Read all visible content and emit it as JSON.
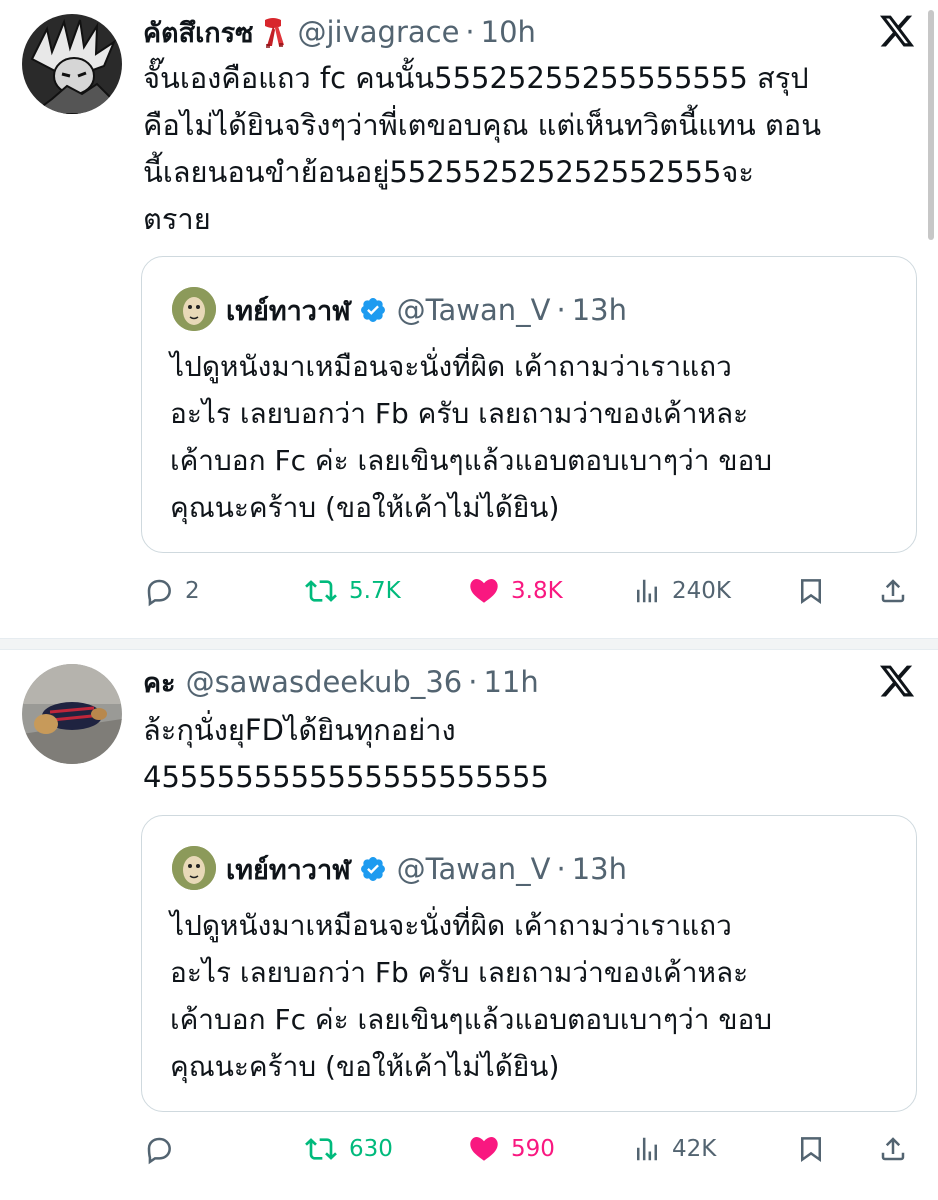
{
  "colors": {
    "muted": "#536471",
    "retweet": "#00ba7c",
    "like": "#f91880",
    "verified": "#1d9bf0",
    "border": "#cfd9de"
  },
  "tweets": [
    {
      "name": "คัตสึเกรซ",
      "name_emoji": "scarf-emoji",
      "handle": "@jivagrace",
      "dot": "·",
      "time": "10h",
      "platform_icon": "x-logo-icon",
      "lines": [
        "จั๊นเองคือแถว fc คนนั้น55525255255555555 สรุป",
        "คือไม่ได้ยินจริงๆว่าพี่เตขอบคุณ แต่เห็นทวิตนี้แทน ตอน",
        "นี้เลยนอนขำย้อนอยู่552552525252552555จะ",
        "ตราย"
      ],
      "quote": {
        "name": "เทย์ทาวาฬ",
        "handle": "@Tawan_V",
        "dot": "·",
        "time": "13h",
        "lines": [
          "ไปดูหนังมาเหมือนจะนั่งที่ผิด เค้าถามว่าเราแถว",
          "อะไร เลยบอกว่า Fb ครับ เลยถามว่าของเค้าหละ",
          "เค้าบอก Fc ค่ะ เลยเขินๆแล้วแอบตอบเบาๆว่า ขอบ",
          "คุณนะคร้าบ (ขอให้เค้าไม่ได้ยิน)"
        ]
      },
      "actions": {
        "replies": "2",
        "retweets": "5.7K",
        "likes": "3.8K",
        "views": "240K"
      }
    },
    {
      "name": "คะ",
      "handle": "@sawasdeekub_36",
      "dot": "·",
      "time": "11h",
      "platform_icon": "x-logo-icon",
      "lines": [
        "ล้ะกุนั่งยุFDได้ยินทุกอย่าง",
        "4555555555555555555555"
      ],
      "quote": {
        "name": "เทย์ทาวาฬ",
        "handle": "@Tawan_V",
        "dot": "·",
        "time": "13h",
        "lines": [
          "ไปดูหนังมาเหมือนจะนั่งที่ผิด เค้าถามว่าเราแถว",
          "อะไร เลยบอกว่า Fb ครับ เลยถามว่าของเค้าหละ",
          "เค้าบอก Fc ค่ะ เลยเขินๆแล้วแอบตอบเบาๆว่า ขอบ",
          "คุณนะคร้าบ (ขอให้เค้าไม่ได้ยิน)"
        ]
      },
      "actions": {
        "replies": "",
        "retweets": "630",
        "likes": "590",
        "views": "42K"
      }
    }
  ]
}
